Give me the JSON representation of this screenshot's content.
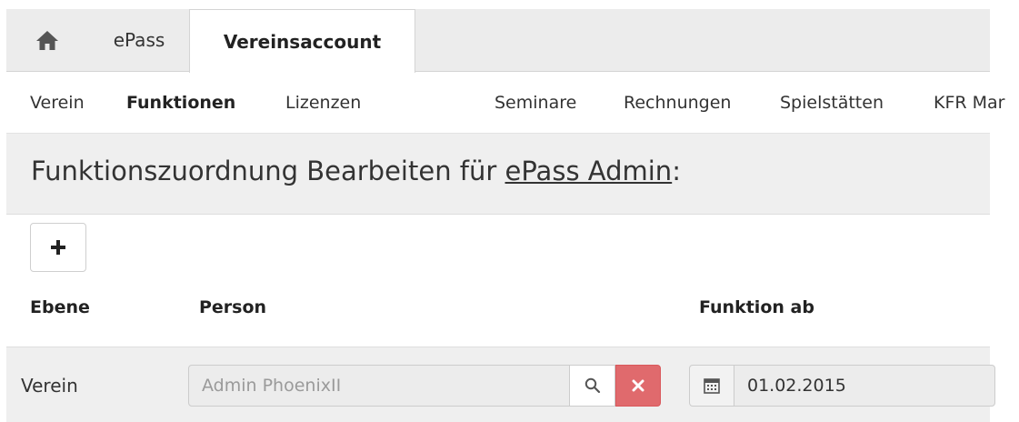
{
  "tabs": {
    "home_icon": "home-icon",
    "epass": "ePass",
    "active": "Vereinsaccount"
  },
  "subnav": {
    "items": [
      "Verein",
      "Funktionen",
      "Lizenzen",
      "Seminare",
      "Rechnungen",
      "Spielstätten",
      "KFR Mar"
    ],
    "active_index": 1
  },
  "heading": {
    "prefix": "Funktionszuordnung Bearbeiten für ",
    "link": "ePass Admin",
    "suffix": ":"
  },
  "add_button": {
    "icon": "plus-icon"
  },
  "table": {
    "columns": [
      "Ebene",
      "Person",
      "Funktion ab"
    ],
    "row": {
      "ebene": "Verein",
      "person": "Admin PhoenixII",
      "date": "01.02.2015",
      "icons": [
        "search-icon",
        "close-icon",
        "calendar-icon"
      ]
    }
  },
  "colors": {
    "clear_button": "#e06a6d",
    "bar_background": "#efefef"
  }
}
